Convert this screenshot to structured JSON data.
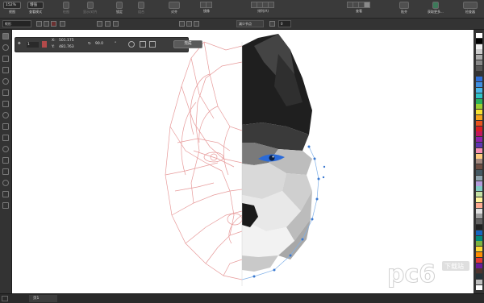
{
  "toolbar": {
    "zoom_value": "152%",
    "view_mode_value": "增强",
    "labels": [
      "视图",
      "查看模式",
      "绘图",
      "显示/对齐",
      "锁定",
      "组合",
      "对齐",
      "镜像",
      "排列(A)",
      "查看",
      "贴齐",
      "获取更多...",
      "检查器"
    ]
  },
  "propbar": {
    "object_type": "矩形",
    "nodes_label": "减少节点",
    "nodes_value": "0"
  },
  "transform_panel": {
    "step_value": "1",
    "x_label": "X:",
    "x_value": "501.175",
    "y_label": "Y:",
    "y_value": "481.763",
    "angle_value": "90.0",
    "apply_label": "完成"
  },
  "statusbar": {
    "page_tab": "页1"
  },
  "watermark": {
    "brand": "pc6",
    "sub": "下载站"
  },
  "palette_colors": [
    "#ffffff",
    "#000000",
    "#eeeeee",
    "#cccccc",
    "#aaaaaa",
    "#888888",
    "#555555",
    "#333333",
    "#2f6fd6",
    "#3f8ee0",
    "#49b7e8",
    "#2ec3c8",
    "#2ab05a",
    "#9acd32",
    "#f5e132",
    "#f3a21c",
    "#e8531e",
    "#d91f26",
    "#c2185b",
    "#8e24aa",
    "#5e35b1",
    "#f48fb1",
    "#ffcc80",
    "#a1887f",
    "#6d4c41",
    "#455a64",
    "#90a4ae",
    "#b39ddb",
    "#80cbc4",
    "#c5e1a5",
    "#fff59d",
    "#ffab91",
    "#e0e0e0",
    "#9e9e9e",
    "#616161",
    "#212121",
    "#1565c0",
    "#00897b",
    "#7cb342",
    "#fdd835",
    "#fb8c00",
    "#e53935",
    "#6a1b9a",
    "#4e342e",
    "#263238",
    "#bdbdbd",
    "#ffffff"
  ],
  "icons": {
    "toolbox": [
      "pick-tool-icon",
      "shape-tool-icon",
      "crop-tool-icon",
      "zoom-tool-icon",
      "freehand-tool-icon",
      "artistic-media-icon",
      "rectangle-tool-icon",
      "ellipse-tool-icon",
      "polygon-tool-icon",
      "text-tool-icon",
      "parallel-dimension-icon",
      "connector-tool-icon",
      "shadow-tool-icon",
      "transparency-tool-icon",
      "eyedropper-tool-icon",
      "fill-tool-icon"
    ]
  }
}
